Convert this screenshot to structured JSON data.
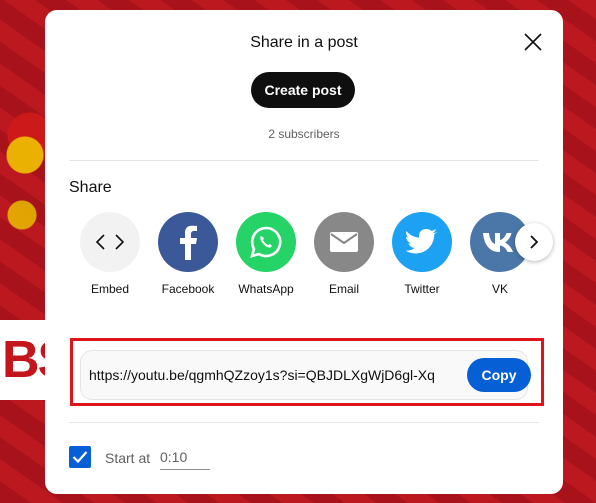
{
  "dialog": {
    "title": "Share in a post",
    "create_post_label": "Create post",
    "subscribers": "2 subscribers"
  },
  "share": {
    "heading": "Share",
    "items": [
      {
        "label": "Embed",
        "icon": "embed-icon",
        "color": "#f2f2f2"
      },
      {
        "label": "Facebook",
        "icon": "facebook-icon",
        "color": "#3b5998"
      },
      {
        "label": "WhatsApp",
        "icon": "whatsapp-icon",
        "color": "#25d366"
      },
      {
        "label": "Email",
        "icon": "email-icon",
        "color": "#888888"
      },
      {
        "label": "Twitter",
        "icon": "twitter-icon",
        "color": "#1da1f2"
      },
      {
        "label": "VK",
        "icon": "vk-icon",
        "color": "#4a76a8"
      }
    ]
  },
  "link": {
    "url": "https://youtu.be/qgmhQZzoy1s?si=QBJDLXgWjD6gl-Xq",
    "copy_label": "Copy"
  },
  "start_at": {
    "label": "Start at",
    "value": "0:10",
    "checked": true
  },
  "colors": {
    "accent": "#065fd4",
    "highlight": "#e0131b"
  }
}
